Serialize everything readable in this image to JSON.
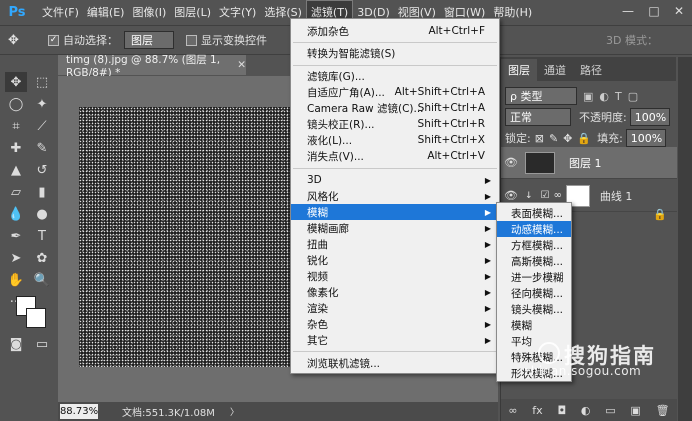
{
  "app": {
    "logo": "Ps"
  },
  "menubar": {
    "items": [
      {
        "label": "文件(F)"
      },
      {
        "label": "编辑(E)"
      },
      {
        "label": "图像(I)"
      },
      {
        "label": "图层(L)"
      },
      {
        "label": "文字(Y)"
      },
      {
        "label": "选择(S)"
      },
      {
        "label": "滤镜(T)",
        "active": true
      },
      {
        "label": "3D(D)"
      },
      {
        "label": "视图(V)"
      },
      {
        "label": "窗口(W)"
      },
      {
        "label": "帮助(H)"
      }
    ],
    "window_controls": [
      "—",
      "□",
      "✕"
    ]
  },
  "options": {
    "auto_select_label": "自动选择：",
    "auto_select_checked": true,
    "layer_select": "图层",
    "show_transform_label": "显示变换控件",
    "mode_3d_label": "3D 模式："
  },
  "document": {
    "tab_title": "timg (8).jpg @ 88.7% (图层 1, RGB/8#) *",
    "zoom": "88.73%",
    "doc_info": "文档:551.3K/1.08M"
  },
  "filter_menu": {
    "items": [
      {
        "label": "添加杂色",
        "shortcut": "Alt+Ctrl+F"
      },
      {
        "label": "转换为智能滤镜(S)"
      },
      {
        "label": "滤镜库(G)..."
      },
      {
        "label": "自适应广角(A)...",
        "shortcut": "Alt+Shift+Ctrl+A"
      },
      {
        "label": "Camera Raw 滤镜(C)...",
        "shortcut": "Shift+Ctrl+A"
      },
      {
        "label": "镜头校正(R)...",
        "shortcut": "Shift+Ctrl+R"
      },
      {
        "label": "液化(L)...",
        "shortcut": "Shift+Ctrl+X"
      },
      {
        "label": "消失点(V)...",
        "shortcut": "Alt+Ctrl+V"
      },
      {
        "label": "3D",
        "submenu": true
      },
      {
        "label": "风格化",
        "submenu": true
      },
      {
        "label": "模糊",
        "submenu": true,
        "highlighted": true
      },
      {
        "label": "模糊画廊",
        "submenu": true
      },
      {
        "label": "扭曲",
        "submenu": true
      },
      {
        "label": "锐化",
        "submenu": true
      },
      {
        "label": "视频",
        "submenu": true
      },
      {
        "label": "像素化",
        "submenu": true
      },
      {
        "label": "渲染",
        "submenu": true
      },
      {
        "label": "杂色",
        "submenu": true
      },
      {
        "label": "其它",
        "submenu": true
      },
      {
        "label": "浏览联机滤镜..."
      }
    ]
  },
  "blur_submenu": {
    "items": [
      {
        "label": "表面模糊..."
      },
      {
        "label": "动感模糊...",
        "highlighted": true
      },
      {
        "label": "方框模糊..."
      },
      {
        "label": "高斯模糊..."
      },
      {
        "label": "进一步模糊"
      },
      {
        "label": "径向模糊..."
      },
      {
        "label": "镜头模糊..."
      },
      {
        "label": "模糊"
      },
      {
        "label": "平均"
      },
      {
        "label": "特殊模糊..."
      },
      {
        "label": "形状模糊..."
      }
    ]
  },
  "layers_panel": {
    "tabs": [
      "图层",
      "通道",
      "路径"
    ],
    "filter_kind": "ρ 类型",
    "blend_mode": "正常",
    "opacity_label": "不透明度:",
    "opacity_value": "100%",
    "lock_label": "锁定:",
    "fill_label": "填充:",
    "fill_value": "100%",
    "layers": [
      {
        "name": "图层 1",
        "active": true
      },
      {
        "name": "曲线 1"
      }
    ],
    "bottom_icons": [
      "link-icon",
      "fx-icon",
      "mask-icon",
      "adjustment-icon",
      "group-icon",
      "new-layer-icon",
      "trash-icon"
    ]
  },
  "watermark": {
    "text": "搜狗指南",
    "url": "zhinan.sogou.com"
  },
  "colors": {
    "menu_highlight": "#1e77d8",
    "ui_background": "#535353",
    "menu_background": "#f0f0f0"
  }
}
